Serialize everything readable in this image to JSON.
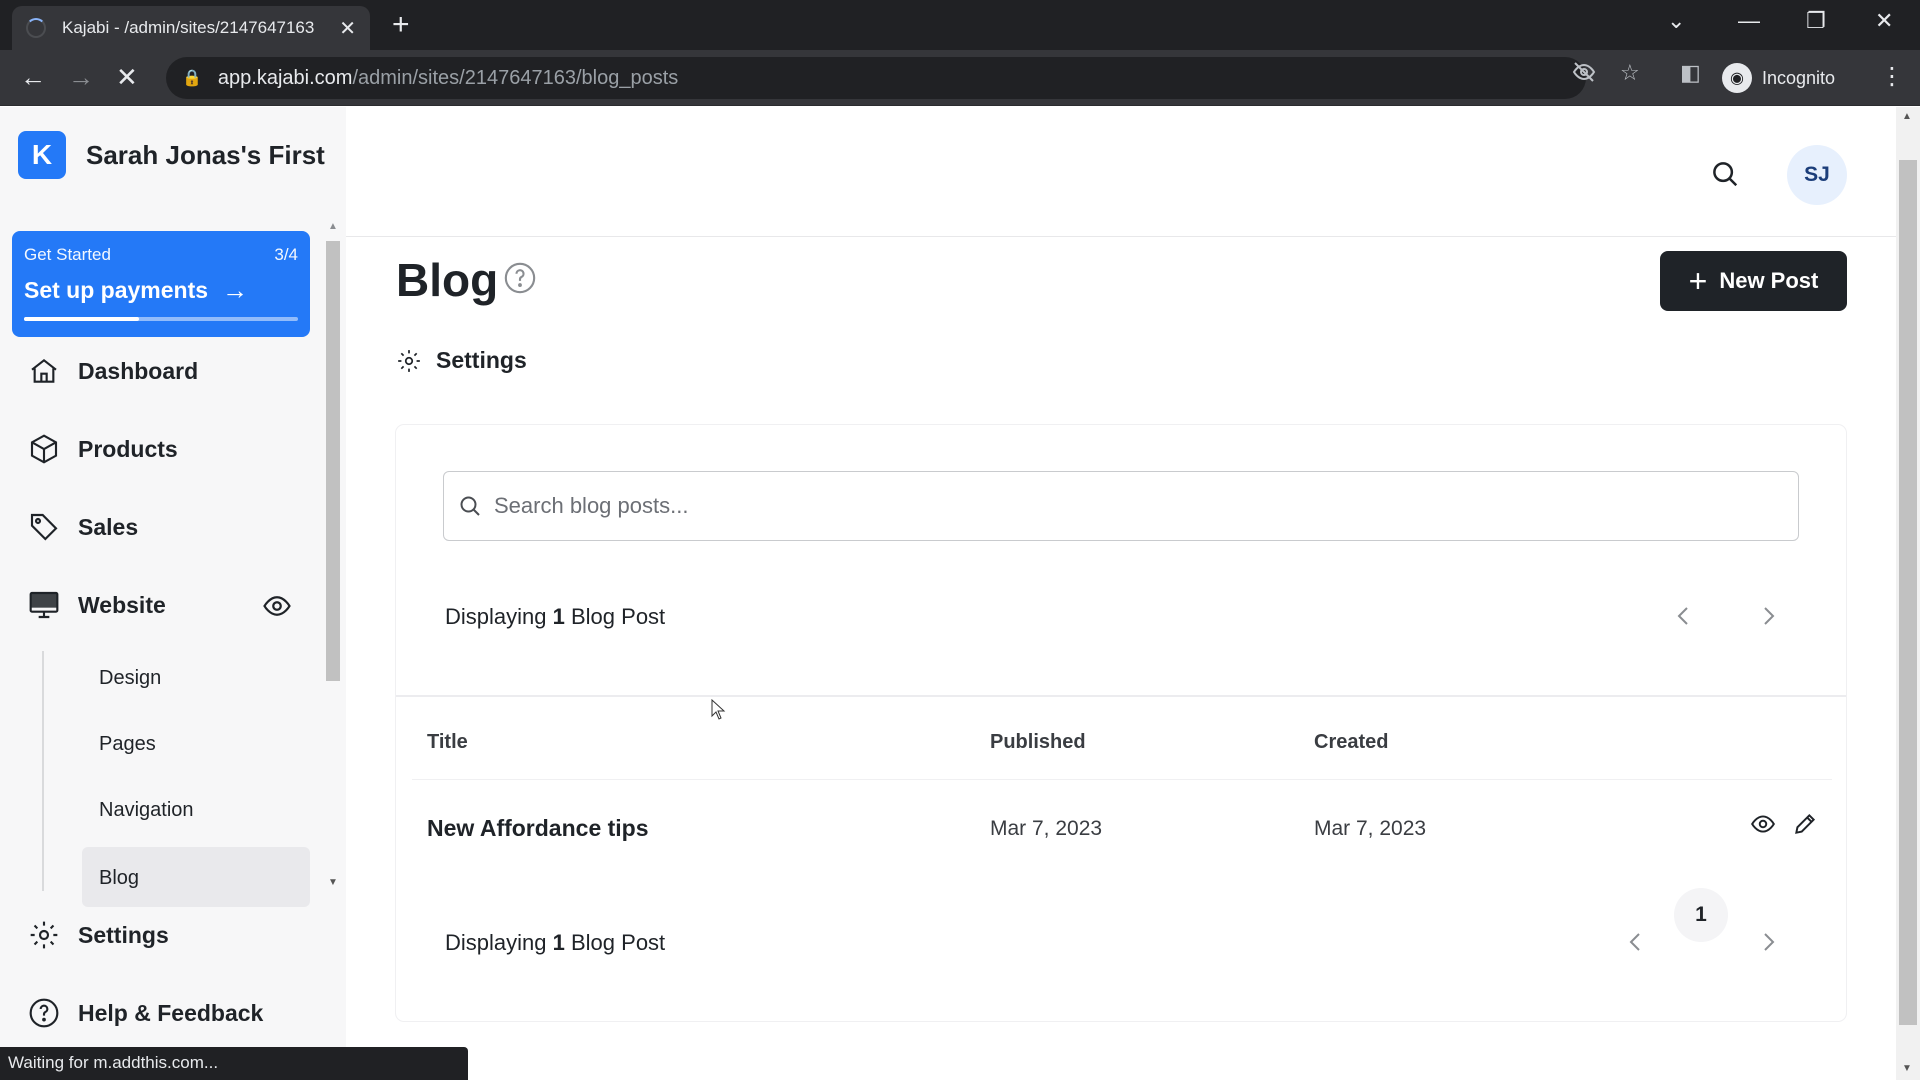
{
  "browser": {
    "tab_title": "Kajabi - /admin/sites/2147647163",
    "url_host": "app.kajabi.com",
    "url_path": "/admin/sites/2147647163/blog_posts",
    "profile_label": "Incognito",
    "status_text": "Waiting for m.addthis.com..."
  },
  "sidebar": {
    "site_name": "Sarah Jonas's First",
    "get_started": {
      "label": "Get Started",
      "progress_text": "3/4",
      "progress_fraction": 0.42,
      "action": "Set up payments"
    },
    "nav": {
      "dashboard": "Dashboard",
      "products": "Products",
      "sales": "Sales",
      "website": "Website",
      "settings": "Settings",
      "help": "Help & Feedback"
    },
    "website_sub": {
      "design": "Design",
      "pages": "Pages",
      "navigation": "Navigation",
      "blog": "Blog"
    }
  },
  "header": {
    "user_initials": "SJ"
  },
  "page": {
    "title": "Blog",
    "new_post_label": "New Post",
    "settings_label": "Settings",
    "search_placeholder": "Search blog posts...",
    "displaying_prefix": "Displaying",
    "displaying_count": "1",
    "displaying_suffix": "Blog Post",
    "current_page": "1"
  },
  "table": {
    "columns": {
      "title": "Title",
      "published": "Published",
      "created": "Created"
    },
    "rows": [
      {
        "title": "New Affordance tips",
        "published": "Mar 7, 2023",
        "created": "Mar 7, 2023"
      }
    ]
  },
  "colors": {
    "accent": "#2479f7",
    "dark_button": "#1f2328"
  }
}
